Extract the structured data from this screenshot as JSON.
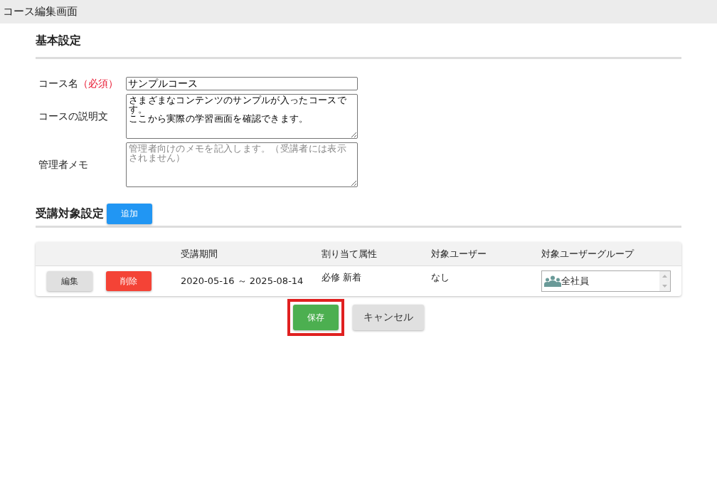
{
  "window": {
    "title": "コース編集画面"
  },
  "basic": {
    "heading": "基本設定",
    "fields": [
      {
        "kind": "input",
        "label": "コース名",
        "required_mark": "（必須）",
        "value": "サンプルコース"
      },
      {
        "kind": "textarea",
        "label": "コースの説明文",
        "lines": [
          "さまざまなコンテンツのサンプルが入ったコースです。",
          "ここから実際の学習画面を確認できます。"
        ]
      },
      {
        "kind": "textarea",
        "label": "管理者メモ",
        "placeholder": "管理者向けのメモを記入します。（受講者には表示されません）"
      }
    ]
  },
  "target": {
    "heading": "受講対象設定",
    "add_button": "追加",
    "table": {
      "columns": [
        "受講期間",
        "割り当て属性",
        "対象ユーザー",
        "対象ユーザーグループ"
      ],
      "rows": [
        {
          "edit": "編集",
          "delete": "削除",
          "period": "2020-05-16 ～ 2025-08-14",
          "attributes": "必修 新着",
          "users": "なし",
          "groups": [
            "全社員"
          ]
        }
      ]
    }
  },
  "actions": [
    {
      "kind": "primary",
      "label": "保存",
      "highlighted": true
    },
    {
      "kind": "secondary",
      "label": "キャンセル",
      "highlighted": false
    }
  ]
}
